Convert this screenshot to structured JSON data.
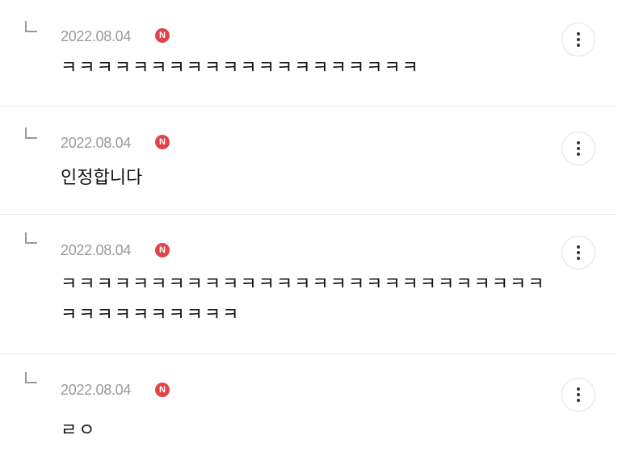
{
  "comments": [
    {
      "date": "2022.08.04",
      "badge": "N",
      "text": "ㅋㅋㅋㅋㅋㅋㅋㅋㅋㅋㅋㅋㅋㅋㅋㅋㅋㅋㅋㅋ"
    },
    {
      "date": "2022.08.04",
      "badge": "N",
      "text": "인정합니다"
    },
    {
      "date": "2022.08.04",
      "badge": "N",
      "text": "ㅋㅋㅋㅋㅋㅋㅋㅋㅋㅋㅋㅋㅋㅋㅋㅋㅋㅋㅋㅋㅋㅋㅋㅋㅋㅋㅋㅋㅋㅋㅋㅋㅋㅋㅋㅋㅋ"
    },
    {
      "date": "2022.08.04",
      "badge": "N",
      "text": "ㄹㅇ"
    }
  ]
}
